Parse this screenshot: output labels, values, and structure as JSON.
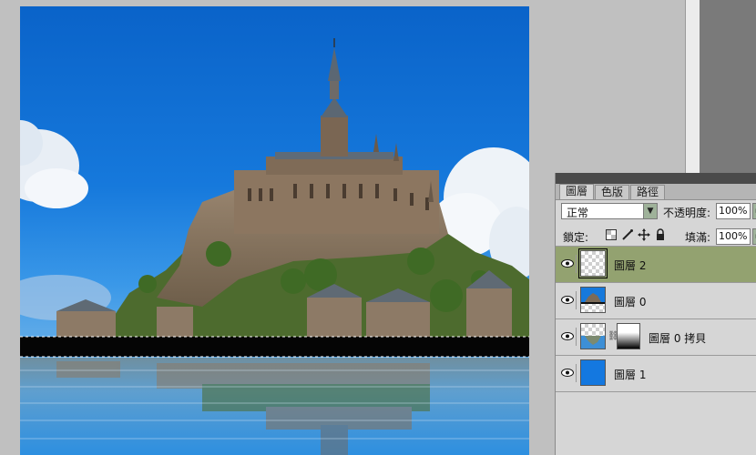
{
  "panel": {
    "tabs": [
      {
        "label": "圖層",
        "active": true
      },
      {
        "label": "色版",
        "active": false
      },
      {
        "label": "路徑",
        "active": false
      }
    ],
    "blend_mode": "正常",
    "opacity_label": "不透明度:",
    "opacity_value": "100%",
    "lock_label": "鎖定:",
    "fill_label": "填滿:",
    "fill_value": "100%",
    "lock_icons": [
      "lock-transparent-icon",
      "lock-image-icon",
      "lock-position-icon",
      "lock-all-icon"
    ]
  },
  "layers": [
    {
      "name": "圖層 2",
      "thumb": "checker",
      "selected": true
    },
    {
      "name": "圖層 0",
      "thumb": "photo",
      "selected": false
    },
    {
      "name": "圖層 0 拷貝",
      "thumb": "checker-photo",
      "mask": true,
      "selected": false
    },
    {
      "name": "圖層 1",
      "thumb": "blue",
      "selected": false
    }
  ],
  "colors": {
    "selected_layer": "#93a270",
    "sky_blue": "#1679dc",
    "layer1_fill": "#1478e0"
  }
}
